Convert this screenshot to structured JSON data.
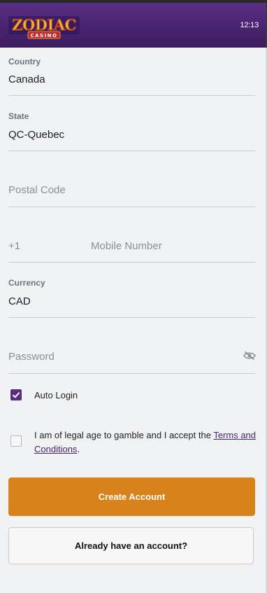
{
  "header": {
    "logo_word": "ZODIAC",
    "logo_sub": "CASINO",
    "time": "12:13"
  },
  "form": {
    "country": {
      "label": "Country",
      "value": "Canada"
    },
    "state": {
      "label": "State",
      "value": "QC-Quebec"
    },
    "postal_code": {
      "placeholder": "Postal Code"
    },
    "mobile": {
      "prefix": "+1",
      "placeholder": "Mobile Number"
    },
    "currency": {
      "label": "Currency",
      "value": "CAD"
    },
    "password": {
      "placeholder": "Password",
      "toggle_icon": "eye-slash-icon"
    },
    "auto_login": {
      "label": "Auto Login",
      "checked": true
    },
    "legal": {
      "text_before": "I am of legal age to gamble and I accept the ",
      "link_text": "Terms and Conditions",
      "text_after": ".",
      "checked": false
    }
  },
  "buttons": {
    "create_account": "Create Account",
    "already_have_account": "Already have an account?"
  },
  "colors": {
    "header_purple": "#4a2470",
    "accent_orange": "#d8821c",
    "checkbox_purple": "#5b2d82"
  }
}
